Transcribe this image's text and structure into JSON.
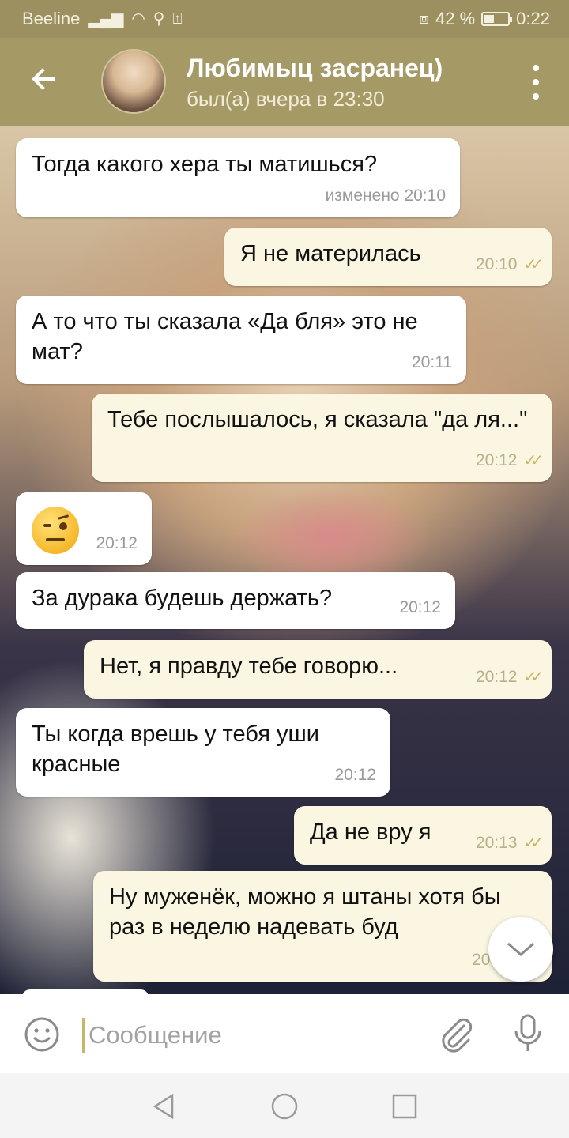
{
  "status_bar": {
    "carrier": "Beeline",
    "battery_text": "42 %",
    "battery_level": 0.42,
    "time": "0:22"
  },
  "header": {
    "back_icon": "arrow-left-icon",
    "title": "Любимыц засранец)",
    "subtitle": "был(а) вчера в 23:30",
    "menu_icon": "more-vertical-icon"
  },
  "messages": [
    {
      "dir": "in",
      "text": "Тогда какого хера ты матишься?",
      "meta": "изменено 20:10"
    },
    {
      "dir": "out",
      "text": "Я не материлась",
      "meta": "20:10"
    },
    {
      "dir": "in",
      "text": "А то что ты сказала «Да бля» это не мат?",
      "meta": "20:11"
    },
    {
      "dir": "out",
      "text": "Тебе послышалось, я сказала \"да ля...\"",
      "meta": "20:12"
    },
    {
      "dir": "in",
      "emoji": "face-with-raised-eyebrow",
      "meta": "20:12"
    },
    {
      "dir": "in",
      "text": "За дурака будешь держать?",
      "meta": "20:12"
    },
    {
      "dir": "out",
      "text": "Нет, я правду тебе говорю...",
      "meta": "20:12"
    },
    {
      "dir": "in",
      "text": "Ты когда врешь у тебя уши красные",
      "meta": "20:12"
    },
    {
      "dir": "out",
      "text": "Да не вру я",
      "meta": "20:13"
    },
    {
      "dir": "out",
      "text": "Ну муженёк, можно я штаны хотя бы раз в неделю надевать буд",
      "meta": "20:1"
    }
  ],
  "composer": {
    "placeholder": "Сообщение",
    "emoji_icon": "smile-icon",
    "attach_icon": "paperclip-icon",
    "mic_icon": "microphone-icon"
  },
  "scroll_down_icon": "chevron-down-icon",
  "navbar": {
    "back_icon": "triangle-back-icon",
    "home_icon": "circle-home-icon",
    "recents_icon": "square-recents-icon"
  },
  "colors": {
    "header": "#a59a66",
    "status_bar": "#9c9060",
    "outgoing_bubble": "#fbf6e2",
    "incoming_bubble": "#ffffff",
    "checkmark": "#c9b46a"
  }
}
